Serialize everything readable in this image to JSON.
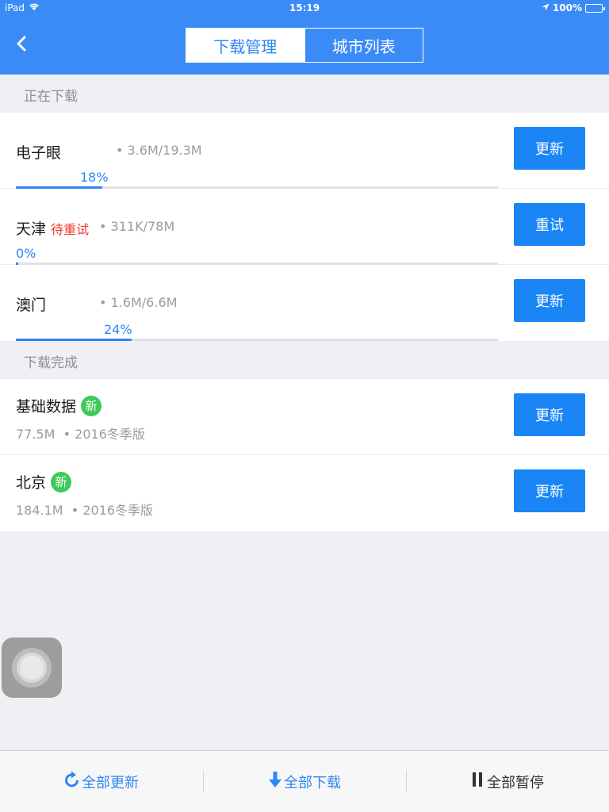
{
  "status_bar": {
    "device": "iPad",
    "time": "15:19",
    "battery": "100%"
  },
  "nav": {
    "tabs": [
      {
        "label": "下载管理",
        "active": true
      },
      {
        "label": "城市列表",
        "active": false
      }
    ]
  },
  "downloading": {
    "title": "正在下载",
    "items": [
      {
        "name": "电子眼",
        "tag": "",
        "size": "3.6M/19.3M",
        "percent_label": "18%",
        "progress": 0.18,
        "button": "更新"
      },
      {
        "name": "天津",
        "tag": "待重试",
        "size": "311K/78M",
        "percent_label": "0%",
        "progress": 0.0,
        "button": "重试"
      },
      {
        "name": "澳门",
        "tag": "",
        "size": "1.6M/6.6M",
        "percent_label": "24%",
        "progress": 0.24,
        "button": "更新"
      }
    ]
  },
  "completed": {
    "title": "下载完成",
    "items": [
      {
        "name": "基础数据",
        "badge": "新",
        "size": "77.5M",
        "version": "2016冬季版",
        "button": "更新"
      },
      {
        "name": "北京",
        "badge": "新",
        "size": "184.1M",
        "version": "2016冬季版",
        "button": "更新"
      }
    ]
  },
  "bottom_bar": {
    "update_all": "全部更新",
    "download_all": "全部下载",
    "pause_all": "全部暂停"
  },
  "colors": {
    "primary": "#3b8bf7",
    "button": "#1a86f6",
    "badge": "#3dca5a",
    "warning": "#f0392b"
  }
}
